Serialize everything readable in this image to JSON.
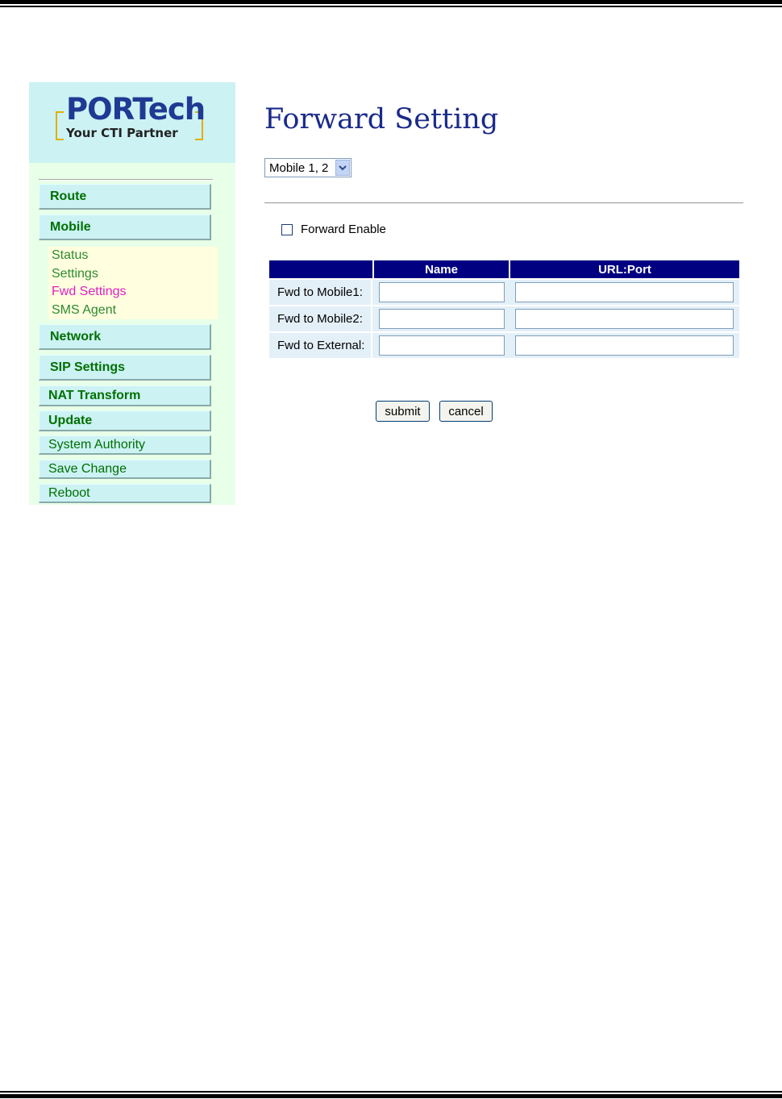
{
  "logo": {
    "brand": "PORTech",
    "tagline": "Your CTI Partner"
  },
  "sidebar": {
    "items": [
      {
        "label": "Route"
      },
      {
        "label": "Mobile"
      },
      {
        "label": "Network"
      },
      {
        "label": "SIP Settings"
      },
      {
        "label": "NAT Transform"
      },
      {
        "label": "Update"
      },
      {
        "label": "System Authority"
      },
      {
        "label": "Save Change"
      },
      {
        "label": "Reboot"
      }
    ],
    "mobile_submenu": [
      {
        "label": "Status"
      },
      {
        "label": "Settings"
      },
      {
        "label": "Fwd Settings",
        "active": true
      },
      {
        "label": "SMS Agent"
      }
    ]
  },
  "main": {
    "title": "Forward Setting",
    "mobile_select": {
      "value": "Mobile 1, 2"
    },
    "forward_enable": {
      "label": "Forward Enable",
      "checked": false
    },
    "table": {
      "headers": [
        "",
        "Name",
        "URL:Port"
      ],
      "rows": [
        {
          "label": "Fwd to Mobile1:",
          "name": "",
          "url_port": ""
        },
        {
          "label": "Fwd to Mobile2:",
          "name": "",
          "url_port": ""
        },
        {
          "label": "Fwd to External:",
          "name": "",
          "url_port": ""
        }
      ]
    },
    "buttons": {
      "submit": "submit",
      "cancel": "cancel"
    }
  },
  "colors": {
    "header_bg": "#000080",
    "nav_bg": "#ccf2f4",
    "nav_text": "#007000",
    "active_sub": "#e020c0",
    "title": "#1a2a8a"
  }
}
